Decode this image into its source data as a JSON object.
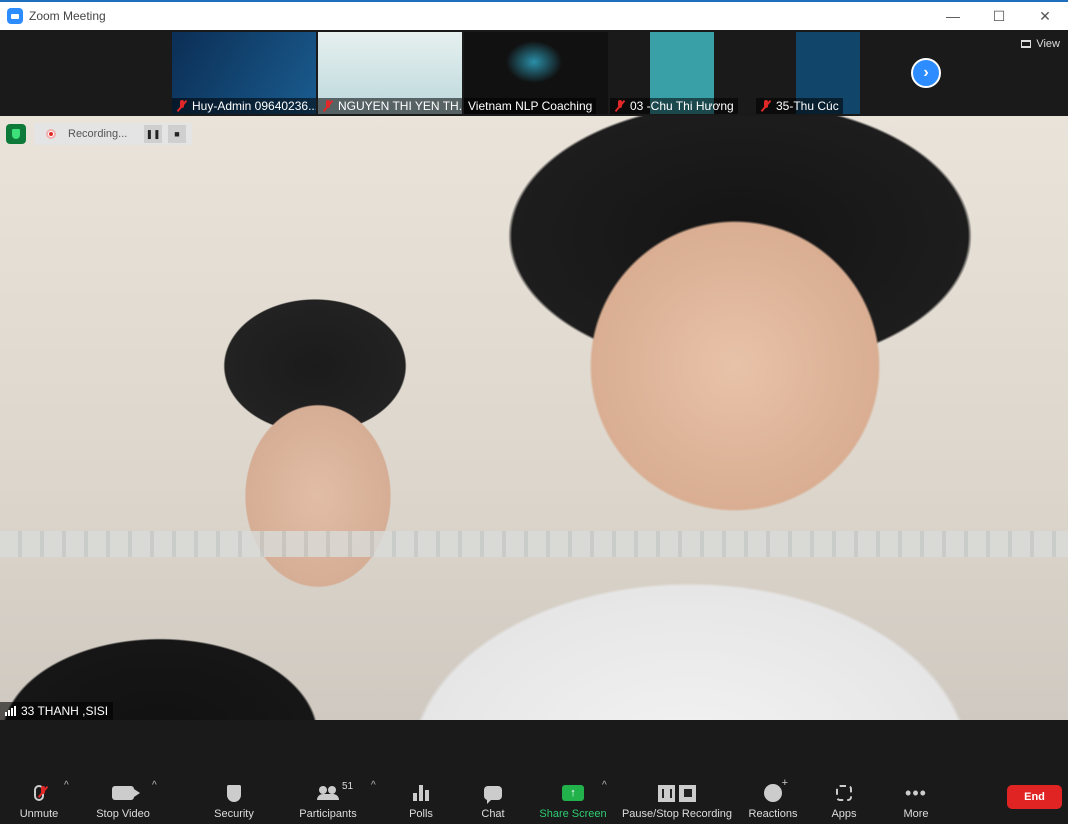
{
  "window": {
    "title": "Zoom Meeting",
    "controls": [
      "—",
      "☐",
      "✕"
    ]
  },
  "thumbnails": [
    {
      "name": "Huy-Admin 09640236...",
      "muted": true,
      "bg": "#0f3a66"
    },
    {
      "name": "NGUYEN THI YEN TH...",
      "muted": true,
      "bg": "#cfe6e8"
    },
    {
      "name": "Vietnam NLP Coaching",
      "muted": false,
      "bg": "#1e1e1e"
    },
    {
      "name": "03  -Chu Thi Hương",
      "muted": true,
      "bg": "#2b7f8c"
    },
    {
      "name": "35-Thu Cúc",
      "muted": true,
      "bg": "#0f4060"
    }
  ],
  "strip": {
    "view_label": "View",
    "next_symbol": "›"
  },
  "recording": {
    "label": "Recording...",
    "pause_symbol": "❚❚",
    "stop_symbol": "■"
  },
  "main_video": {
    "speaker_name": "33 THANH ,SISI"
  },
  "toolbar": {
    "unmute": "Unmute",
    "stop_video": "Stop Video",
    "security": "Security",
    "participants": "Participants",
    "participants_count": "51",
    "polls": "Polls",
    "chat": "Chat",
    "share_screen": "Share Screen",
    "share_symbol": "↑",
    "pause_stop_recording": "Pause/Stop Recording",
    "reactions": "Reactions",
    "apps": "Apps",
    "more": "More",
    "more_symbol": "•••",
    "caret": "^",
    "end": "End"
  },
  "colors": {
    "accent": "#2d8cff",
    "end": "#e02424",
    "share": "#22b24c",
    "muted": "#e02828"
  }
}
